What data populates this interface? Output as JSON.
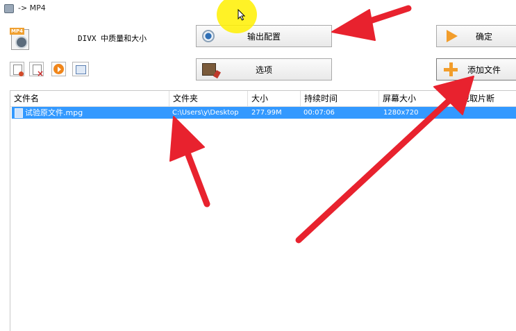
{
  "window": {
    "title": "-> MP4"
  },
  "profile": {
    "name": "DIVX 中质量和大小"
  },
  "buttons": {
    "output_config": "输出配置",
    "options": "选项",
    "ok": "确定",
    "add_file": "添加文件"
  },
  "file_table": {
    "columns": [
      "文件名",
      "文件夹",
      "大小",
      "持续时间",
      "屏幕大小",
      "截取片断"
    ],
    "rows": [
      {
        "name": "试验原文件.mpg",
        "folder": "C:\\Users\\y\\Desktop",
        "size": "277.99M",
        "duration": "00:07:06",
        "screen_size": "1280x720",
        "clip": ""
      }
    ]
  },
  "colors": {
    "selection": "#3399ff",
    "annotation_arrow": "#e8222e",
    "cursor_highlight": "#fff200"
  },
  "icons": [
    "app-icon",
    "video-profile-icon",
    "output-config-icon",
    "options-icon",
    "ok-arrow-icon",
    "add-plus-icon",
    "new-file-icon",
    "remove-file-icon",
    "play-icon",
    "view-icon",
    "file-icon"
  ]
}
